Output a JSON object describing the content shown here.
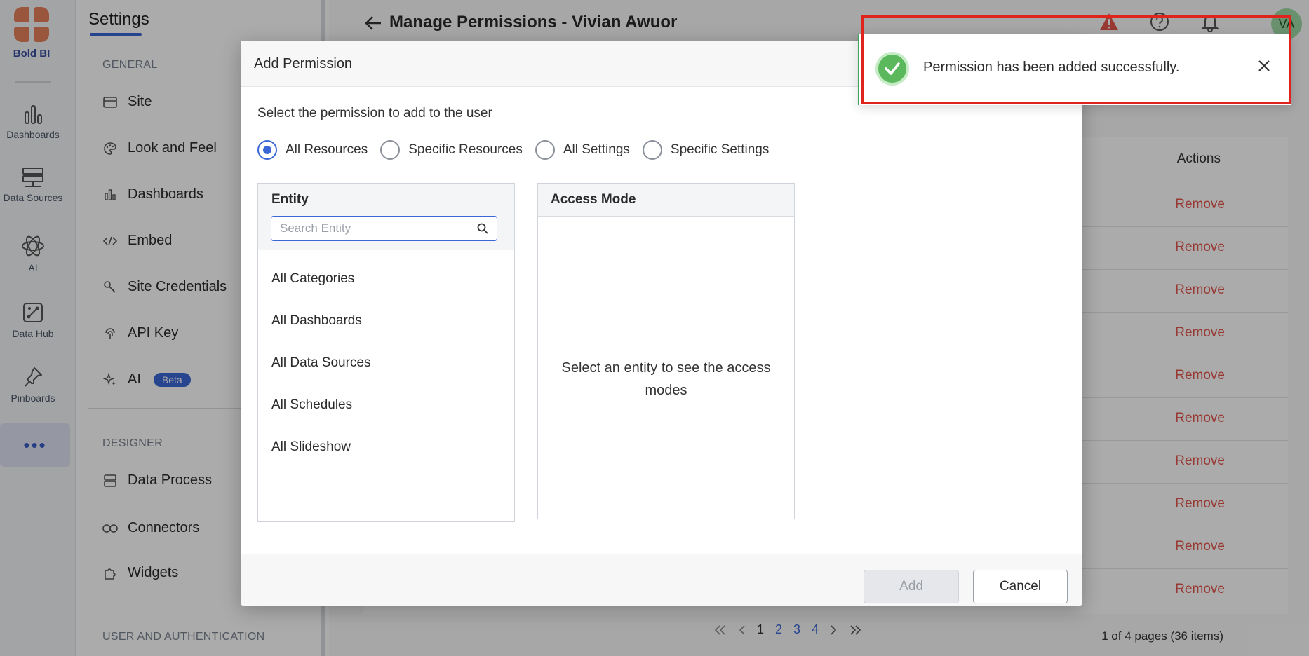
{
  "rail": {
    "brand": "Bold BI",
    "items": [
      {
        "label": "Dashboards",
        "icon": "bar-chart-icon"
      },
      {
        "label": "Data Sources",
        "icon": "database-icon"
      },
      {
        "label": "AI",
        "icon": "atom-icon"
      },
      {
        "label": "Data Hub",
        "icon": "data-hub-icon"
      },
      {
        "label": "Pinboards",
        "icon": "pin-icon"
      }
    ],
    "more": "•••"
  },
  "settings": {
    "title": "Settings",
    "general_label": "GENERAL",
    "general_items": [
      {
        "label": "Site",
        "icon": "site-icon"
      },
      {
        "label": "Look and Feel",
        "icon": "palette-icon"
      },
      {
        "label": "Dashboards",
        "icon": "bar-chart-icon"
      },
      {
        "label": "Embed",
        "icon": "code-icon"
      },
      {
        "label": "Site Credentials",
        "icon": "key-icon"
      },
      {
        "label": "API Key",
        "icon": "fingerprint-icon"
      },
      {
        "label": "AI",
        "icon": "sparkle-icon",
        "badge": "Beta"
      }
    ],
    "designer_label": "DESIGNER",
    "designer_items": [
      {
        "label": "Data Process",
        "icon": "server-icon"
      },
      {
        "label": "Connectors",
        "icon": "link-icon"
      },
      {
        "label": "Widgets",
        "icon": "puzzle-icon"
      }
    ],
    "auth_label": "USER AND AUTHENTICATION"
  },
  "main": {
    "title": "Manage Permissions - Vivian Awuor",
    "avatar": "VA",
    "table_header_actions": "Actions",
    "remove_label": "Remove",
    "row_count": 10,
    "pager_pages": [
      "1",
      "2",
      "3",
      "4"
    ],
    "pager_info": "1 of 4 pages (36 items)"
  },
  "dialog": {
    "title": "Add Permission",
    "subtitle": "Select the permission to add to the user",
    "radios": [
      {
        "label": "All Resources",
        "selected": true
      },
      {
        "label": "Specific Resources",
        "selected": false
      },
      {
        "label": "All Settings",
        "selected": false
      },
      {
        "label": "Specific Settings",
        "selected": false
      }
    ],
    "entity_label": "Entity",
    "search_placeholder": "Search Entity",
    "entities": [
      "All Categories",
      "All Dashboards",
      "All Data Sources",
      "All Schedules",
      "All Slideshow"
    ],
    "access_label": "Access Mode",
    "access_empty": "Select an entity to see the access modes",
    "add_label": "Add",
    "cancel_label": "Cancel"
  },
  "toast": {
    "message": "Permission has been added successfully."
  },
  "colors": {
    "accent": "#3b67d6",
    "remove": "#e3554c",
    "success": "#5cb85c",
    "highlight": "#e0231c",
    "brand": "#e6815a"
  }
}
